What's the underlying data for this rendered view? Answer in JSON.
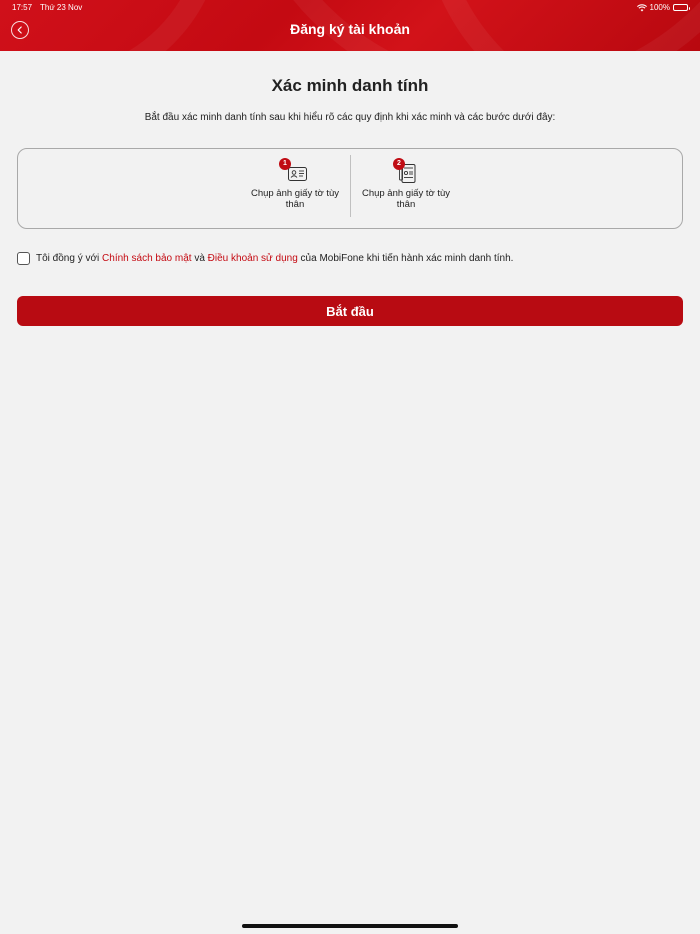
{
  "status_bar": {
    "time": "17:57",
    "date": "Thứ 23 Nov",
    "battery": "100%"
  },
  "header": {
    "title": "Đăng ký tài khoản",
    "back_icon": "chevron-left-icon"
  },
  "main": {
    "title": "Xác minh danh tính",
    "intro": "Bắt đầu xác minh danh tính sau khi hiểu rõ các quy định khi xác minh và các bước dưới đây:",
    "steps": [
      {
        "number": "1",
        "label": "Chụp ảnh giấy tờ tùy thân",
        "icon": "id-card-icon"
      },
      {
        "number": "2",
        "label": "Chụp ảnh giấy tờ tùy thân",
        "icon": "document-icon"
      }
    ],
    "consent": {
      "prefix": "Tôi đồng ý với",
      "privacy_link": "Chính sách bảo mật",
      "and": "và",
      "terms_link": "Điều khoản sử dụng",
      "suffix": "của MobiFone khi tiến hành xác minh danh tính.",
      "checked": false
    },
    "start_button": "Bắt đầu"
  },
  "colors": {
    "brand_red": "#c40a12",
    "button_red": "#b80b12",
    "background": "#f2f2f2"
  }
}
